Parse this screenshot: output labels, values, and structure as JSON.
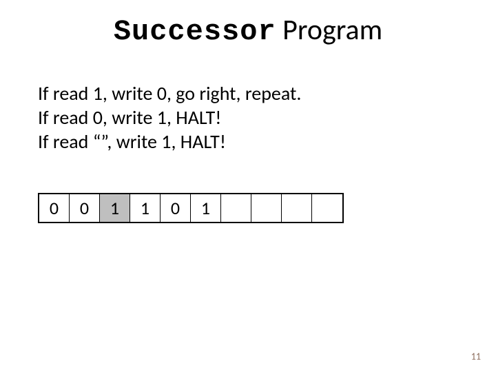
{
  "title": {
    "word1": "Successor",
    "word2": " Program"
  },
  "rules": {
    "line1": "If read 1, write 0, go right, repeat.",
    "line2": "If read 0, write 1, HALT!",
    "line3": "If read “”, write 1, HALT!"
  },
  "tape": {
    "cells": [
      "0",
      "0",
      "1",
      "1",
      "0",
      "1",
      "",
      "",
      "",
      ""
    ],
    "active_index": 2
  },
  "page_number": "11"
}
